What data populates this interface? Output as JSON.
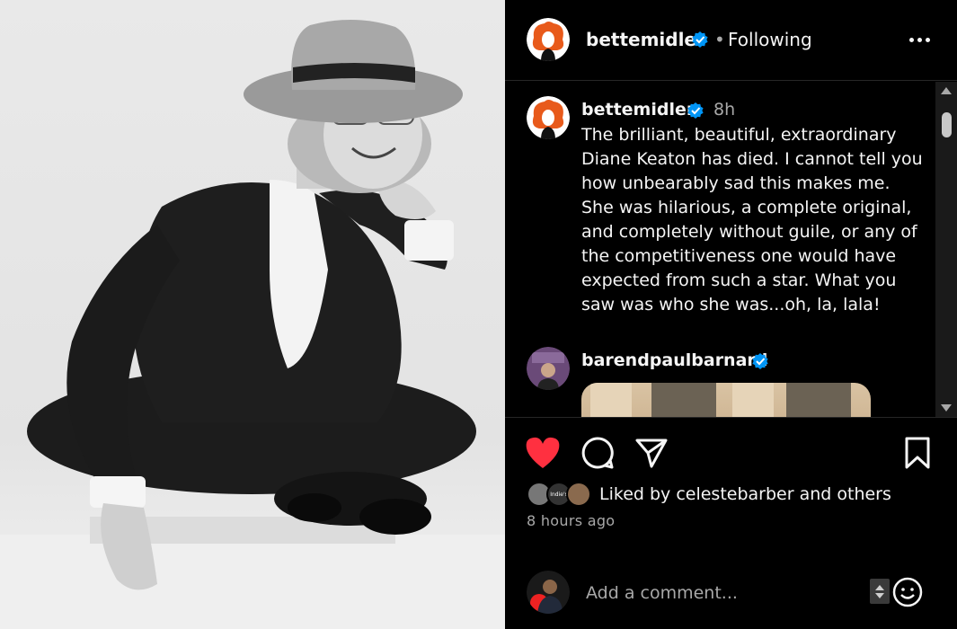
{
  "post": {
    "username": "bettemidler",
    "verified": true,
    "follow_status": "Following",
    "dot": "•",
    "more_icon": "more-horizontal-icon"
  },
  "caption": {
    "username": "bettemidler",
    "time": "8h",
    "text": "The brilliant, beautiful, extraordinary Diane Keaton has died.  I cannot tell you how unbearably sad this makes me. She was hilarious, a complete original, and completely without guile, or any of the competitiveness one would have expected from such a star.  What you saw was who she was...oh, la, lala!"
  },
  "comment2": {
    "username": "barendpaulbarnard",
    "verified": true
  },
  "likes": {
    "liked_by_text": "Liked by celestebarber and others",
    "mini_avatar_label": "Indie's"
  },
  "timestamp": "8 hours ago",
  "add_comment": {
    "placeholder": "Add a comment..."
  },
  "colors": {
    "like_red": "#ff3040",
    "verified_blue": "#0095f6",
    "avatar_orange": "#e85a1b"
  }
}
